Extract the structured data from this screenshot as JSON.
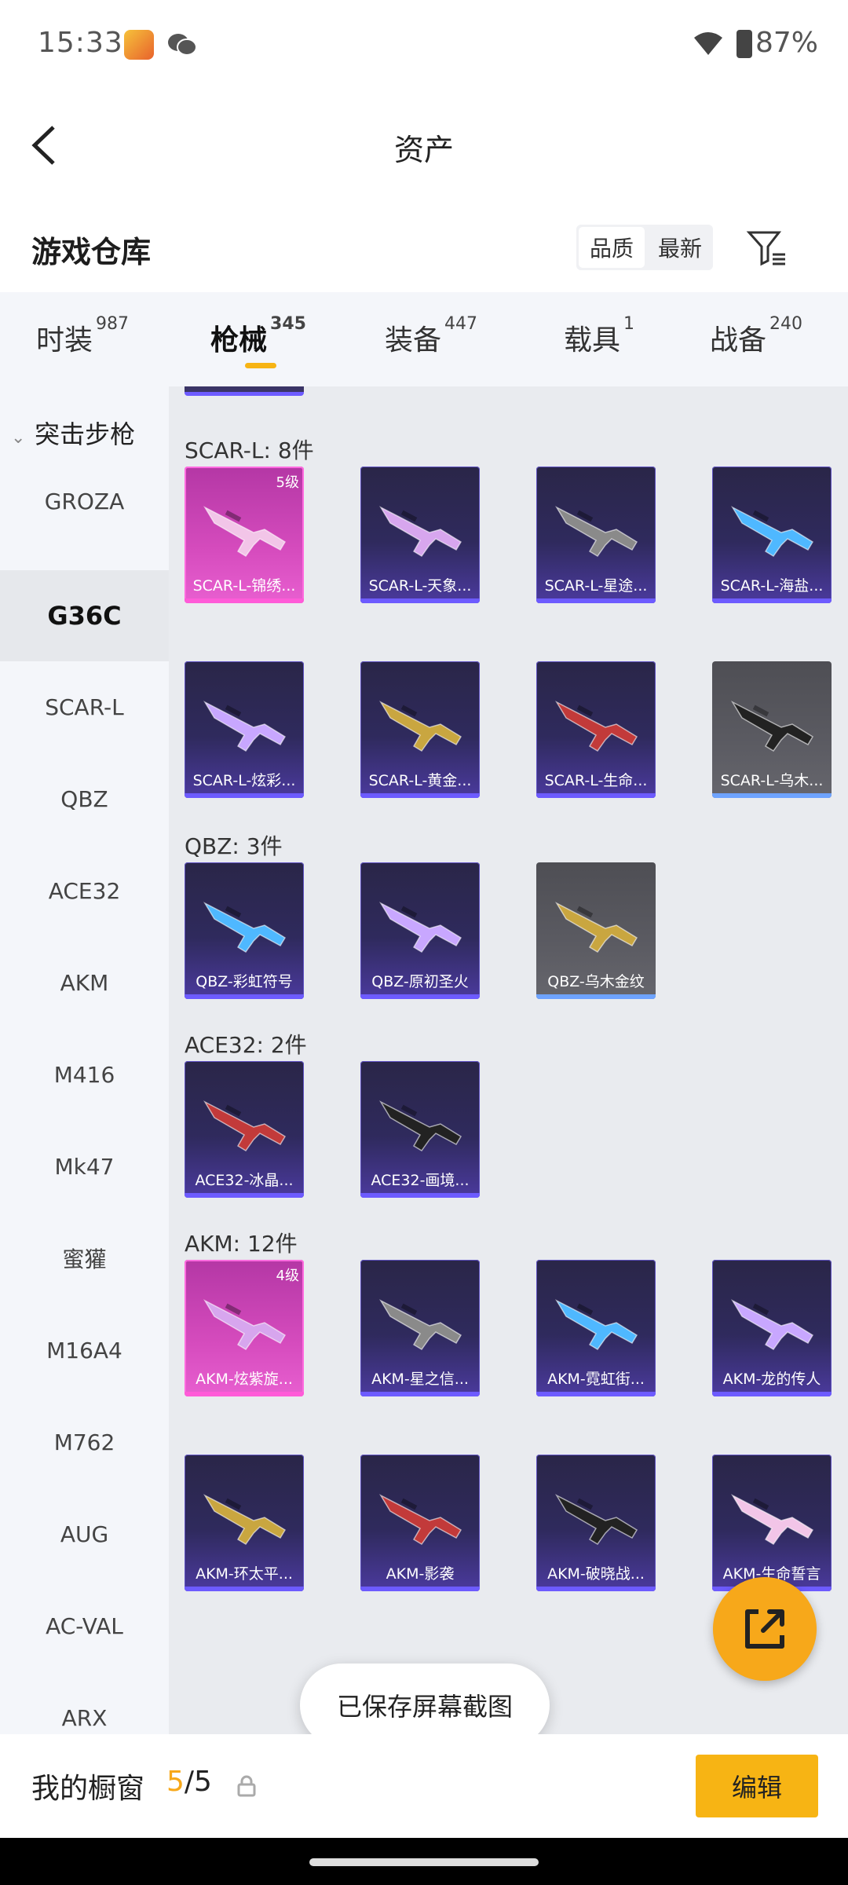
{
  "status_bar": {
    "time": "15:33",
    "battery": "87%"
  },
  "header": {
    "title": "资产"
  },
  "section": {
    "title": "游戏仓库",
    "sort_options": [
      "品质",
      "最新"
    ],
    "active_sort": "品质"
  },
  "tabs": [
    {
      "label": "时装",
      "count": "987"
    },
    {
      "label": "枪械",
      "count": "345",
      "active": true
    },
    {
      "label": "装备",
      "count": "447"
    },
    {
      "label": "载具",
      "count": "1"
    },
    {
      "label": "战备",
      "count": "240"
    }
  ],
  "sidebar": {
    "group": "突击步枪",
    "items": [
      "GROZA",
      "G36C",
      "SCAR-L",
      "QBZ",
      "ACE32",
      "AKM",
      "M416",
      "Mk47",
      "蜜獾",
      "M16A4",
      "M762",
      "AUG",
      "AC-VAL",
      "ARX"
    ],
    "active": "G36C"
  },
  "groups": [
    {
      "label": "SCAR-L: 8件",
      "items": [
        {
          "name": "SCAR-L-锦绣...",
          "level": "5级",
          "style": "epic"
        },
        {
          "name": "SCAR-L-天象...",
          "style": "rare"
        },
        {
          "name": "SCAR-L-星途...",
          "style": "rare"
        },
        {
          "name": "SCAR-L-海盐...",
          "style": "rare"
        },
        {
          "name": "SCAR-L-炫彩...",
          "style": "rare"
        },
        {
          "name": "SCAR-L-黄金...",
          "style": "rare"
        },
        {
          "name": "SCAR-L-生命...",
          "style": "rare"
        },
        {
          "name": "SCAR-L-乌木...",
          "style": "gray"
        }
      ]
    },
    {
      "label": "QBZ: 3件",
      "items": [
        {
          "name": "QBZ-彩虹符号",
          "style": "rare"
        },
        {
          "name": "QBZ-原初圣火",
          "style": "rare"
        },
        {
          "name": "QBZ-乌木金纹",
          "style": "gray"
        }
      ]
    },
    {
      "label": "ACE32: 2件",
      "items": [
        {
          "name": "ACE32-冰晶...",
          "style": "rare"
        },
        {
          "name": "ACE32-画境...",
          "style": "rare"
        }
      ]
    },
    {
      "label": "AKM: 12件",
      "items": [
        {
          "name": "AKM-炫紫旋...",
          "level": "4级",
          "style": "epic"
        },
        {
          "name": "AKM-星之信...",
          "style": "rare"
        },
        {
          "name": "AKM-霓虹街...",
          "style": "rare"
        },
        {
          "name": "AKM-龙的传人",
          "style": "rare"
        },
        {
          "name": "AKM-环太平...",
          "style": "rare"
        },
        {
          "name": "AKM-影袭",
          "style": "rare"
        },
        {
          "name": "AKM-破晓战...",
          "style": "rare"
        },
        {
          "name": "AKM-生命誓言",
          "style": "rare"
        }
      ]
    }
  ],
  "toast": "已保存屏幕截图",
  "showcase": {
    "label": "我的橱窗",
    "current": "5",
    "total": "5"
  },
  "edit_label": "编辑",
  "colors": {
    "accent": "#f7b414",
    "epic": "#d54bbd",
    "rare": "#2f2a5d",
    "gray": "#5b5b62"
  }
}
